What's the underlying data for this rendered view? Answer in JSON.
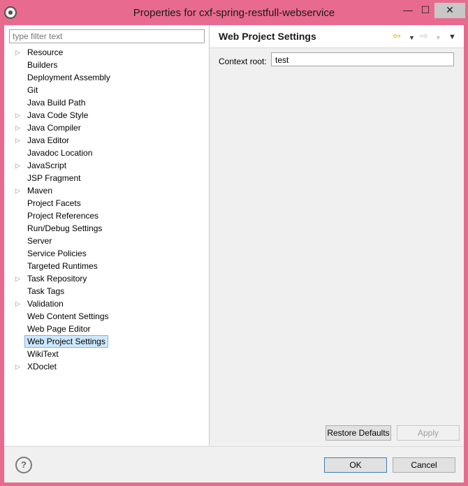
{
  "window": {
    "title": "Properties for cxf-spring-restfull-webservice",
    "minimize_glyph": "—",
    "maximize_glyph": "☐",
    "close_glyph": "✕"
  },
  "filter": {
    "placeholder": "type filter text"
  },
  "tree": {
    "items": [
      {
        "label": "Resource",
        "expandable": true
      },
      {
        "label": "Builders",
        "expandable": false
      },
      {
        "label": "Deployment Assembly",
        "expandable": false
      },
      {
        "label": "Git",
        "expandable": false
      },
      {
        "label": "Java Build Path",
        "expandable": false
      },
      {
        "label": "Java Code Style",
        "expandable": true
      },
      {
        "label": "Java Compiler",
        "expandable": true
      },
      {
        "label": "Java Editor",
        "expandable": true
      },
      {
        "label": "Javadoc Location",
        "expandable": false
      },
      {
        "label": "JavaScript",
        "expandable": true
      },
      {
        "label": "JSP Fragment",
        "expandable": false
      },
      {
        "label": "Maven",
        "expandable": true
      },
      {
        "label": "Project Facets",
        "expandable": false
      },
      {
        "label": "Project References",
        "expandable": false
      },
      {
        "label": "Run/Debug Settings",
        "expandable": false
      },
      {
        "label": "Server",
        "expandable": false
      },
      {
        "label": "Service Policies",
        "expandable": false
      },
      {
        "label": "Targeted Runtimes",
        "expandable": false
      },
      {
        "label": "Task Repository",
        "expandable": true
      },
      {
        "label": "Task Tags",
        "expandable": false
      },
      {
        "label": "Validation",
        "expandable": true
      },
      {
        "label": "Web Content Settings",
        "expandable": false
      },
      {
        "label": "Web Page Editor",
        "expandable": false
      },
      {
        "label": "Web Project Settings",
        "expandable": false,
        "selected": true
      },
      {
        "label": "WikiText",
        "expandable": false
      },
      {
        "label": "XDoclet",
        "expandable": true
      }
    ]
  },
  "page": {
    "title": "Web Project Settings",
    "context_root_label": "Context root:",
    "context_root_value": "test",
    "restore_defaults": "Restore Defaults",
    "apply": "Apply"
  },
  "nav": {
    "back_glyph": "⇦",
    "forward_glyph": "⇨",
    "menu_glyph": "▼"
  },
  "footer": {
    "help_glyph": "?",
    "ok": "OK",
    "cancel": "Cancel"
  },
  "colors": {
    "titlebar": "#e96a8f",
    "selection": "#cde8ff",
    "back_arrow": "#e3a700"
  }
}
